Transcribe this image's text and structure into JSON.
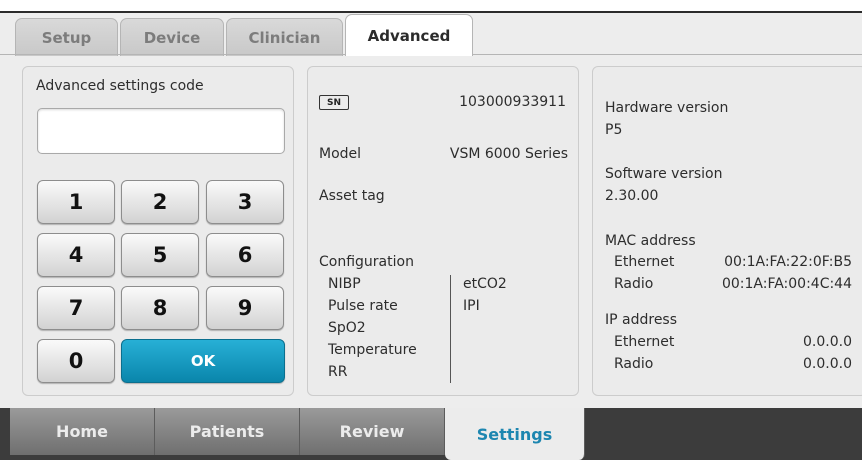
{
  "tabs": {
    "setup": "Setup",
    "device": "Device",
    "clinician": "Clinician",
    "advanced": "Advanced"
  },
  "code_panel": {
    "label": "Advanced settings code",
    "value": "",
    "keys": [
      "1",
      "2",
      "3",
      "4",
      "5",
      "6",
      "7",
      "8",
      "9",
      "0"
    ],
    "ok": "OK",
    "ok_color": "#1a9cc4"
  },
  "device_info": {
    "sn_badge": "SN",
    "serial": "103000933911",
    "model_label": "Model",
    "model_value": "VSM 6000 Series",
    "asset_tag_label": "Asset tag",
    "configuration_label": "Configuration",
    "config_left": [
      "NIBP",
      "Pulse rate",
      "SpO2",
      "Temperature",
      "RR"
    ],
    "config_right": [
      "etCO2",
      "IPI"
    ]
  },
  "versions": {
    "hardware_label": "Hardware version",
    "hardware_value": "P5",
    "software_label": "Software version",
    "software_value": "2.30.00",
    "mac_label": "MAC address",
    "mac_ethernet_label": "Ethernet",
    "mac_ethernet_value": "00:1A:FA:22:0F:B5",
    "mac_radio_label": "Radio",
    "mac_radio_value": "00:1A:FA:00:4C:44",
    "ip_label": "IP address",
    "ip_ethernet_label": "Ethernet",
    "ip_ethernet_value": "0.0.0.0",
    "ip_radio_label": "Radio",
    "ip_radio_value": "0.0.0.0"
  },
  "bottom_nav": {
    "home": "Home",
    "patients": "Patients",
    "review": "Review",
    "settings": "Settings"
  }
}
